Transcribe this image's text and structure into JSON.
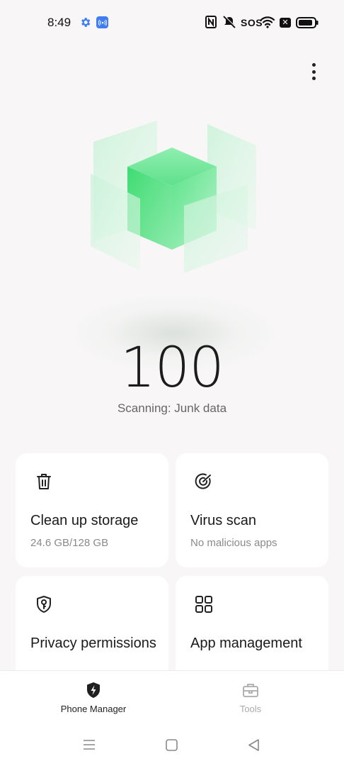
{
  "status_bar": {
    "time": "8:49",
    "sos": "SOS",
    "icons": [
      "gear-icon",
      "cast-icon",
      "nfc-icon",
      "mute-icon",
      "wifi-icon",
      "close-box-icon",
      "battery-icon"
    ]
  },
  "header": {
    "more_icon": "more-vertical-icon"
  },
  "hero": {
    "score": "100",
    "status": "Scanning: Junk data",
    "accent": "#33d96c"
  },
  "cards": {
    "clean": {
      "title": "Clean up storage",
      "subtitle": "24.6 GB/128 GB",
      "icon": "trash-icon"
    },
    "virus": {
      "title": "Virus scan",
      "subtitle": "No malicious apps",
      "icon": "radar-icon"
    },
    "privacy": {
      "title": "Privacy permissions",
      "icon": "shield-key-icon"
    },
    "apps": {
      "title": "App management",
      "icon": "grid-icon"
    }
  },
  "bottom_nav": {
    "tabs": [
      {
        "label": "Phone Manager",
        "icon": "shield-bolt-icon",
        "active": true
      },
      {
        "label": "Tools",
        "icon": "toolbox-icon",
        "active": false
      }
    ]
  },
  "system_nav": [
    "menu-icon",
    "home-icon",
    "back-icon"
  ]
}
